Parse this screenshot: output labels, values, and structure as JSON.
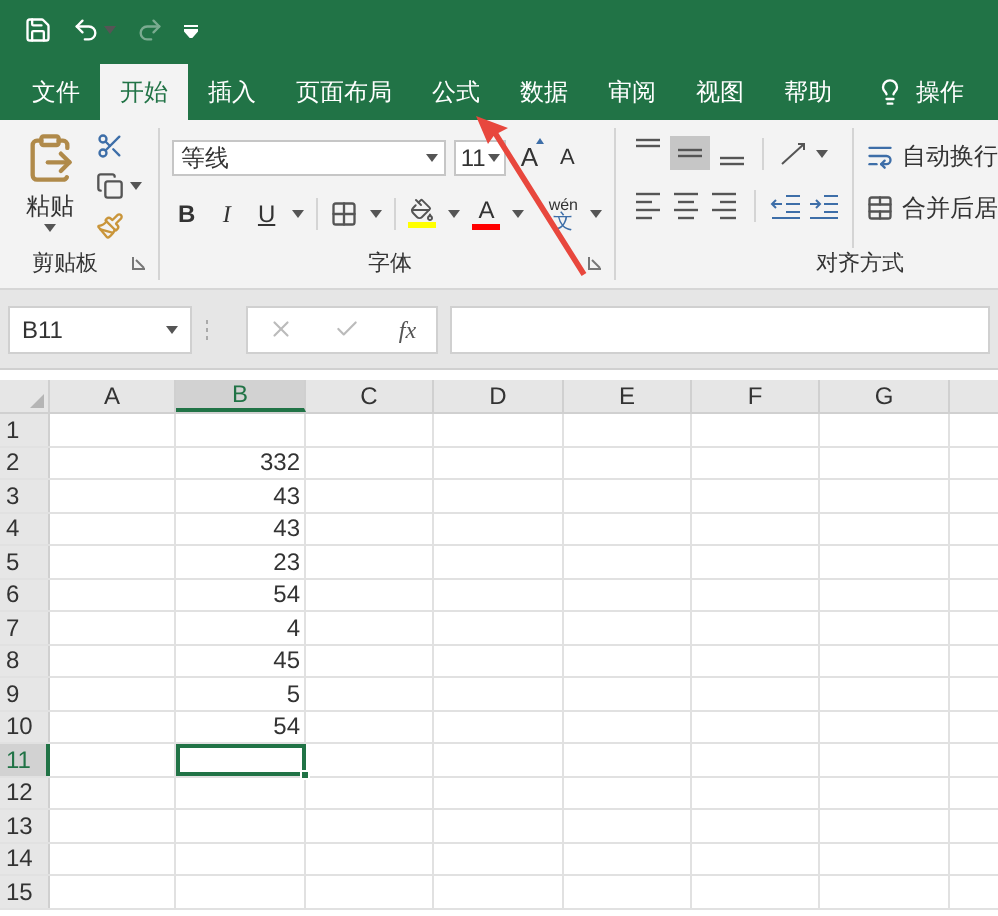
{
  "tabs": [
    {
      "label": "文件",
      "selected": false
    },
    {
      "label": "开始",
      "selected": true
    },
    {
      "label": "插入",
      "selected": false
    },
    {
      "label": "页面布局",
      "selected": false
    },
    {
      "label": "公式",
      "selected": false
    },
    {
      "label": "数据",
      "selected": false
    },
    {
      "label": "审阅",
      "selected": false
    },
    {
      "label": "视图",
      "selected": false
    },
    {
      "label": "帮助",
      "selected": false
    }
  ],
  "tell_me": "操作",
  "clipboard": {
    "paste": "粘贴",
    "group_label": "剪贴板"
  },
  "font": {
    "name": "等线",
    "size": "11",
    "bold": "B",
    "italic": "I",
    "underline": "U",
    "font_color": "A",
    "phonetic": "wén",
    "phonetic_char": "文",
    "grow": "A",
    "shrink": "A",
    "group_label": "字体"
  },
  "alignment": {
    "wrap_text": "自动换行",
    "merge_center": "合并后居",
    "group_label": "对齐方式",
    "middle_align_selected": true
  },
  "formula_bar": {
    "name_box": "B11",
    "fx": "fx"
  },
  "sheet": {
    "columns": [
      {
        "label": "A",
        "selected": false
      },
      {
        "label": "B",
        "selected": true
      },
      {
        "label": "C",
        "selected": false
      },
      {
        "label": "D",
        "selected": false
      },
      {
        "label": "E",
        "selected": false
      },
      {
        "label": "F",
        "selected": false
      },
      {
        "label": "G",
        "selected": false
      }
    ],
    "rows": [
      {
        "label": "1",
        "selected": false,
        "b": ""
      },
      {
        "label": "2",
        "selected": false,
        "b": "332"
      },
      {
        "label": "3",
        "selected": false,
        "b": "43"
      },
      {
        "label": "4",
        "selected": false,
        "b": "43"
      },
      {
        "label": "5",
        "selected": false,
        "b": "23"
      },
      {
        "label": "6",
        "selected": false,
        "b": "54"
      },
      {
        "label": "7",
        "selected": false,
        "b": "4"
      },
      {
        "label": "8",
        "selected": false,
        "b": "45"
      },
      {
        "label": "9",
        "selected": false,
        "b": "5"
      },
      {
        "label": "10",
        "selected": false,
        "b": "54"
      },
      {
        "label": "11",
        "selected": true,
        "b": ""
      },
      {
        "label": "12",
        "selected": false,
        "b": ""
      },
      {
        "label": "13",
        "selected": false,
        "b": ""
      },
      {
        "label": "14",
        "selected": false,
        "b": ""
      },
      {
        "label": "15",
        "selected": false,
        "b": ""
      }
    ]
  }
}
